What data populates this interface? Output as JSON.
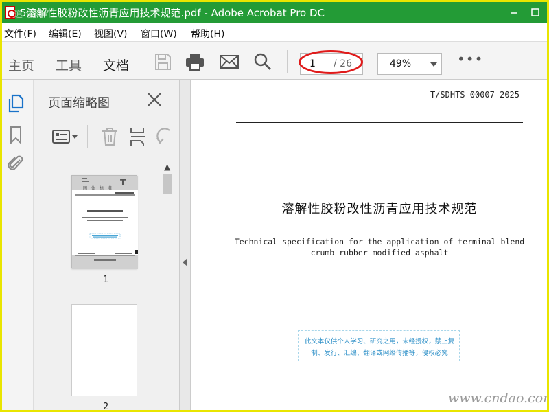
{
  "window": {
    "title": "5溶解性胶粉改性沥青应用技术规范.pdf - Adobe Acrobat Pro DC",
    "watermark_overlay": "道 谈网"
  },
  "menu": {
    "items": [
      "文件(F)",
      "编辑(E)",
      "视图(V)",
      "窗口(W)",
      "帮助(H)"
    ]
  },
  "toolbar": {
    "tabs": [
      "主页",
      "工具",
      "文档"
    ],
    "active_tab": "文档",
    "icons": [
      "save-icon",
      "print-icon",
      "mail-icon",
      "search-icon"
    ],
    "page_current": "1",
    "page_total": "/ 26",
    "zoom": "49%",
    "more": "•••"
  },
  "left_rail": {
    "icons": [
      "page-thumbnails-icon",
      "bookmark-icon",
      "attachment-icon"
    ]
  },
  "thumbnail_panel": {
    "title": "页面缩略图",
    "thumbnails": [
      {
        "label": "1",
        "selected": true
      },
      {
        "label": "2",
        "selected": false
      }
    ]
  },
  "document": {
    "code": "T/SDHTS 00007-2025",
    "title": "溶解性胶粉改性沥青应用技术规范",
    "subtitle_line1": "Technical specification for the application of terminal blend",
    "subtitle_line2": "crumb rubber modified asphalt",
    "notice_line1": "此文本仅供个人学习、研究之用，未经授权，禁止复",
    "notice_line2": "制、发行、汇编、翻译或网络传播等，侵权必究",
    "site_watermark": "www.cndao.com"
  },
  "colors": {
    "titlebar": "#239b36",
    "outer_frame": "#e9e500",
    "annotation_ellipse": "#e01a1a",
    "active_rail_icon": "#1a73c9",
    "notice_text": "#2e90c8"
  }
}
